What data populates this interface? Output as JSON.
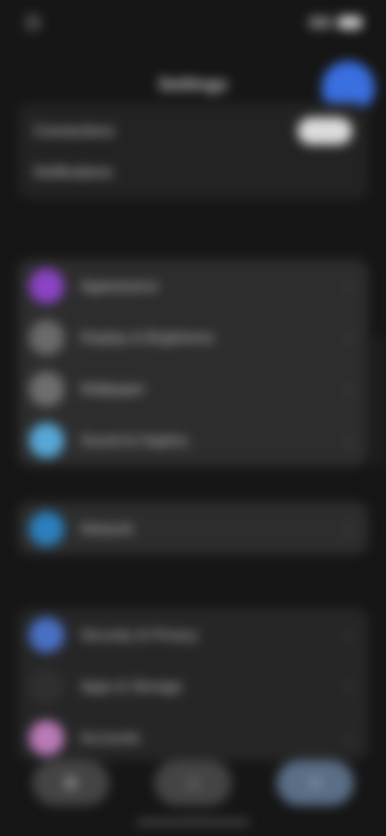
{
  "status": {
    "time": "",
    "battery_label": ""
  },
  "header": {
    "title": "Settings"
  },
  "top": {
    "row1_label": "Connections",
    "row2_label": "Notifications",
    "row2_value": ""
  },
  "sections": {
    "s1": "",
    "s2": ""
  },
  "list1": [
    {
      "label": "Appearance",
      "icon": "palette-icon",
      "color": "#8a44c4"
    },
    {
      "label": "Display & Brightness",
      "icon": "display-icon",
      "color": "#6a6a6a"
    },
    {
      "label": "Wallpaper",
      "icon": "image-icon",
      "color": "#6e6e6e"
    },
    {
      "label": "Sound & Haptics",
      "icon": "sound-icon",
      "color": "#57a7d6"
    }
  ],
  "list2": [
    {
      "label": "Network",
      "icon": "network-icon",
      "color": "#2b7fbd"
    }
  ],
  "list3": [
    {
      "label": "Security & Privacy",
      "icon": "shield-icon",
      "color": "#4a70c6"
    },
    {
      "label": "Apps & Storage",
      "icon": "apps-icon",
      "color": "#2f2f2f"
    },
    {
      "label": "Accounts",
      "icon": "account-icon",
      "color": "#b97ab8"
    }
  ],
  "dock": {
    "b1": "⚙",
    "b2": "☆",
    "b3": "≡"
  },
  "colors": {
    "background": "#161616",
    "card": "#2d2d2d",
    "accent": "#3a6fe0"
  }
}
